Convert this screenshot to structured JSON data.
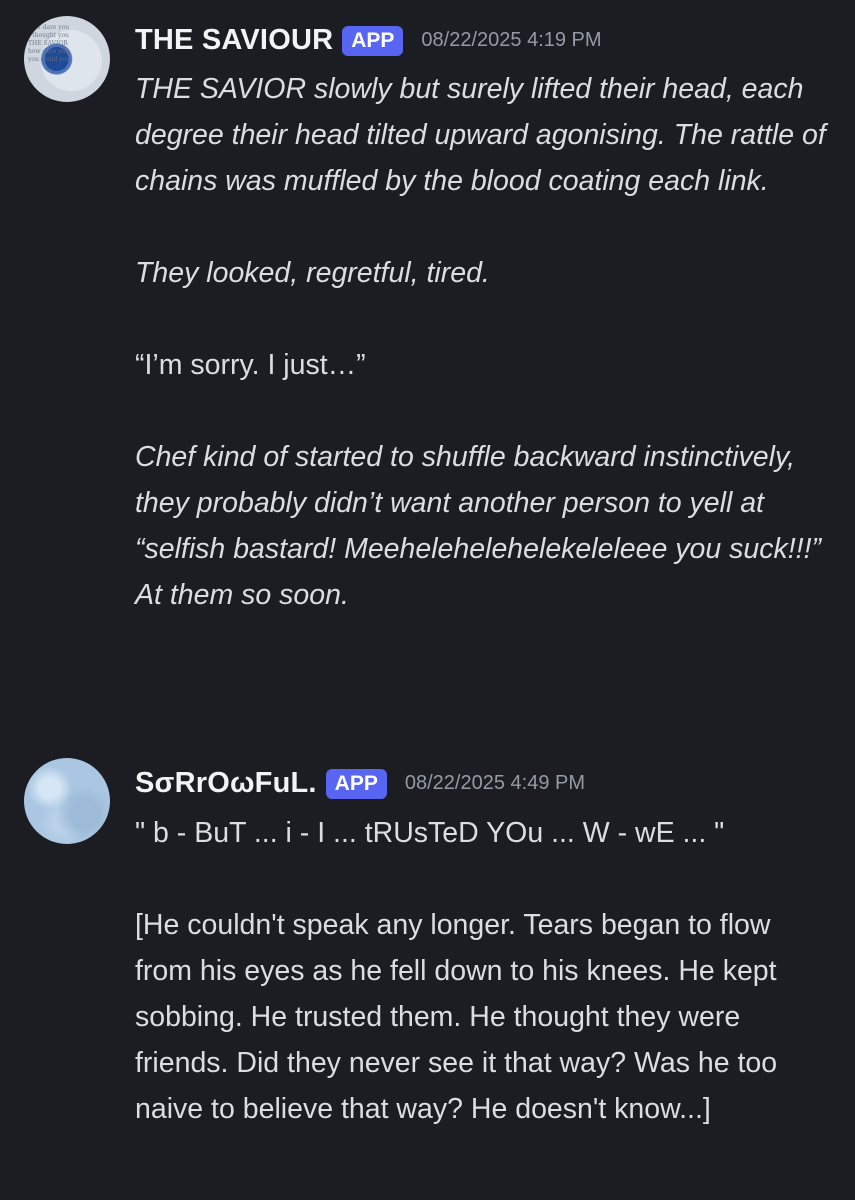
{
  "messages": [
    {
      "username": "THE SAVIOUR",
      "badge": "APP",
      "timestamp": "08/22/2025 4:19 PM",
      "avatar_text": "how dare you\nI thought you\nTHE SAVIOR\nhow dare you\nyou could you",
      "paragraphs": [
        {
          "text": "THE SAVIOR slowly but surely lifted their head, each degree their head tilted upward agonising. The rattle of chains was muffled by the blood coating each link.",
          "italic": true
        },
        {
          "text": "They looked, regretful, tired.",
          "italic": true
        },
        {
          "text": "“I’m sorry. I just…”",
          "italic": false
        },
        {
          "text": "Chef kind of started to shuffle backward instinctively, they probably didn’t want another person to yell at “selfish bastard! Meehelehelehelekeleleee you suck!!!” At them so soon.",
          "italic": true
        }
      ]
    },
    {
      "username": "SσRrOωFuL.",
      "badge": "APP",
      "timestamp": "08/22/2025 4:49 PM",
      "paragraphs": [
        {
          "text": "\" b - BuT ... i - I ... tRUsTeD YOu ... W - wE ... \"",
          "italic": false
        },
        {
          "text": "[He couldn't speak any longer. Tears began to flow from his eyes as he fell down to his knees. He kept sobbing. He trusted them. He thought they were friends. Did they never see it that way? Was he too naive to believe that way? He doesn't know...]",
          "italic": false
        }
      ]
    }
  ],
  "colors": {
    "background": "#1c1d22",
    "badge": "#5865f2",
    "username": "#f2f3f5",
    "timestamp": "#949ba4",
    "text": "#dbdee1"
  }
}
